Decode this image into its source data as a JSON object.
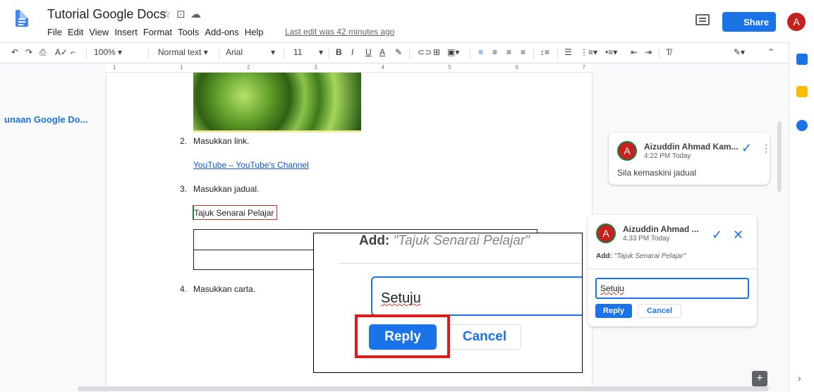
{
  "app": {
    "doc_title": "Tutorial Google Docs",
    "menu": [
      "File",
      "Edit",
      "View",
      "Insert",
      "Format",
      "Tools",
      "Add-ons",
      "Help"
    ],
    "last_edit": "Last edit was 42 minutes ago",
    "share_label": "Share",
    "avatar_letter": "A"
  },
  "toolbar": {
    "zoom": "100%",
    "style": "Normal text",
    "font": "Arial",
    "size": "11"
  },
  "ruler": [
    "1",
    "1",
    "2",
    "3",
    "4",
    "5",
    "6",
    "7"
  ],
  "outline": {
    "item": "unaan Google Do..."
  },
  "document": {
    "item2_num": "2.",
    "item2_text": "Masukkan link.",
    "link_text": "YouTube – YouTube's Channel",
    "item3_num": "3.",
    "item3_text": "Masukkan jadual.",
    "table_title": "Tajuk Senarai Pelajar",
    "item4_num": "4.",
    "item4_text": "Masukkan carta."
  },
  "zoom_overlay": {
    "add_label": "Add:",
    "add_quote": "\"Tajuk Senarai Pelajar\"",
    "input_value": "Setuju",
    "reply_label": "Reply",
    "cancel_label": "Cancel"
  },
  "comment1": {
    "avatar": "A",
    "author": "Aizuddin Ahmad Kam...",
    "time": "4:22 PM Today",
    "text": "Sila kemaskini jadual"
  },
  "comment2": {
    "avatar": "A",
    "author": "Aizuddin Ahmad ...",
    "time": "4:33 PM Today",
    "add_label": "Add:",
    "add_quote": "\"Tajuk Senarai Pelajar\"",
    "input_value": "Setuju",
    "reply_label": "Reply",
    "cancel_label": "Cancel"
  },
  "colors": {
    "accent": "#1a73e8",
    "highlight": "#e01b1b",
    "avatar": "#c5221f"
  }
}
